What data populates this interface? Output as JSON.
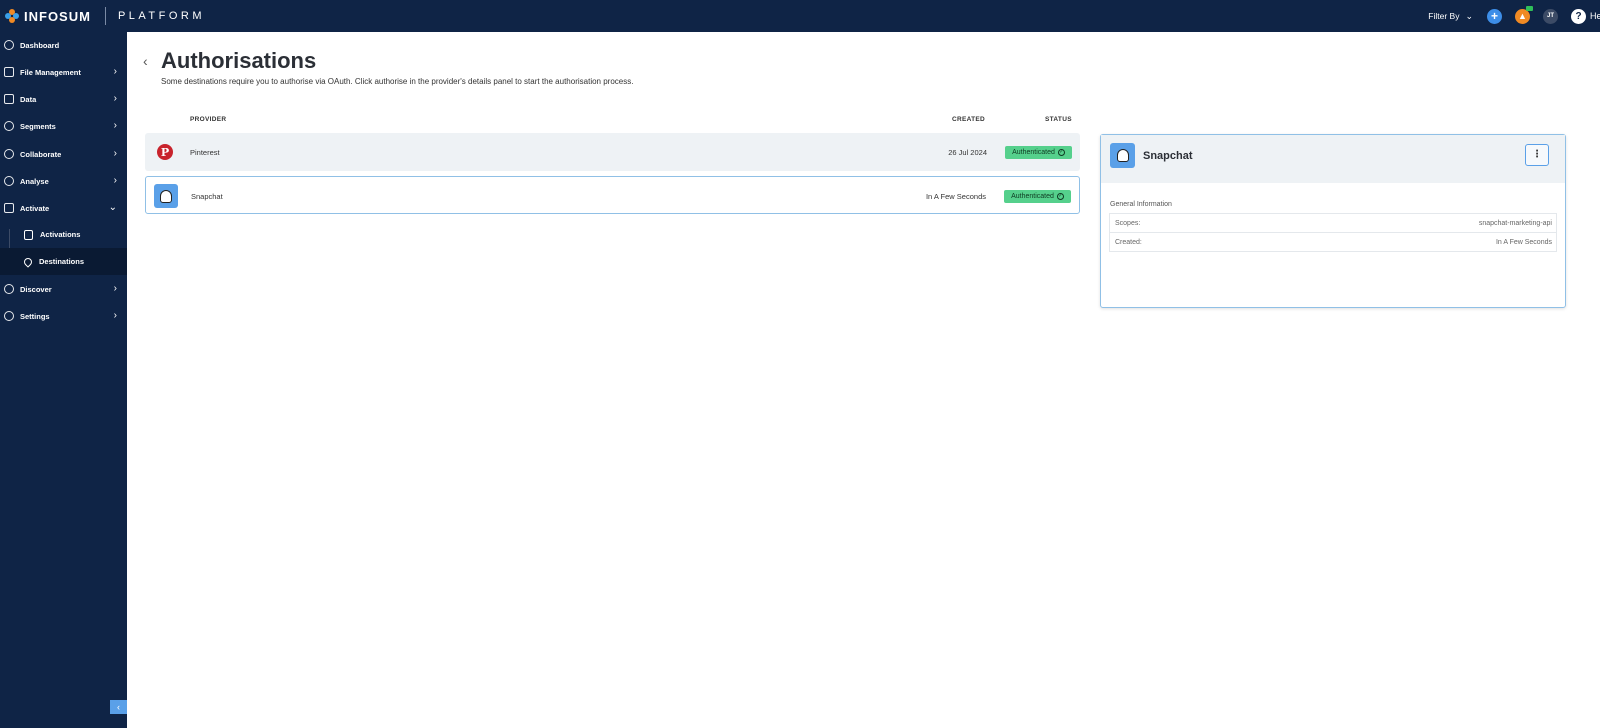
{
  "topbar": {
    "brand": "INFOSUM",
    "product": "PLATFORM",
    "filter_label": "Filter By",
    "avatar_initials": "JT",
    "help_label": "Help"
  },
  "sidebar": {
    "items": [
      {
        "label": "Dashboard"
      },
      {
        "label": "File Management"
      },
      {
        "label": "Data"
      },
      {
        "label": "Segments"
      },
      {
        "label": "Collaborate"
      },
      {
        "label": "Analyse"
      },
      {
        "label": "Activate"
      },
      {
        "label": "Discover"
      },
      {
        "label": "Settings"
      }
    ],
    "sub_items": [
      {
        "label": "Activations"
      },
      {
        "label": "Destinations"
      }
    ]
  },
  "page": {
    "title": "Authorisations",
    "description": "Some destinations require you to authorise via OAuth. Click authorise in the provider's details panel to start the authorisation process."
  },
  "table": {
    "columns": {
      "provider": "PROVIDER",
      "created": "CREATED",
      "status": "STATUS"
    },
    "rows": [
      {
        "provider": "Pinterest",
        "created": "26 Jul 2024",
        "status": "Authenticated",
        "icon": "pinterest-icon",
        "brand_color": "#c8232c"
      },
      {
        "provider": "Snapchat",
        "created": "In A Few Seconds",
        "status": "Authenticated",
        "icon": "snapchat-icon",
        "brand_color": "#5aa0e8"
      }
    ]
  },
  "details": {
    "title": "Snapchat",
    "section": "General Information",
    "fields": [
      {
        "label": "Scopes:",
        "value": "snapchat-marketing-api"
      },
      {
        "label": "Created:",
        "value": "In A Few Seconds"
      }
    ]
  },
  "colors": {
    "nav_bg": "#0f2446",
    "accent": "#5aa0e8",
    "success": "#55d08c"
  }
}
